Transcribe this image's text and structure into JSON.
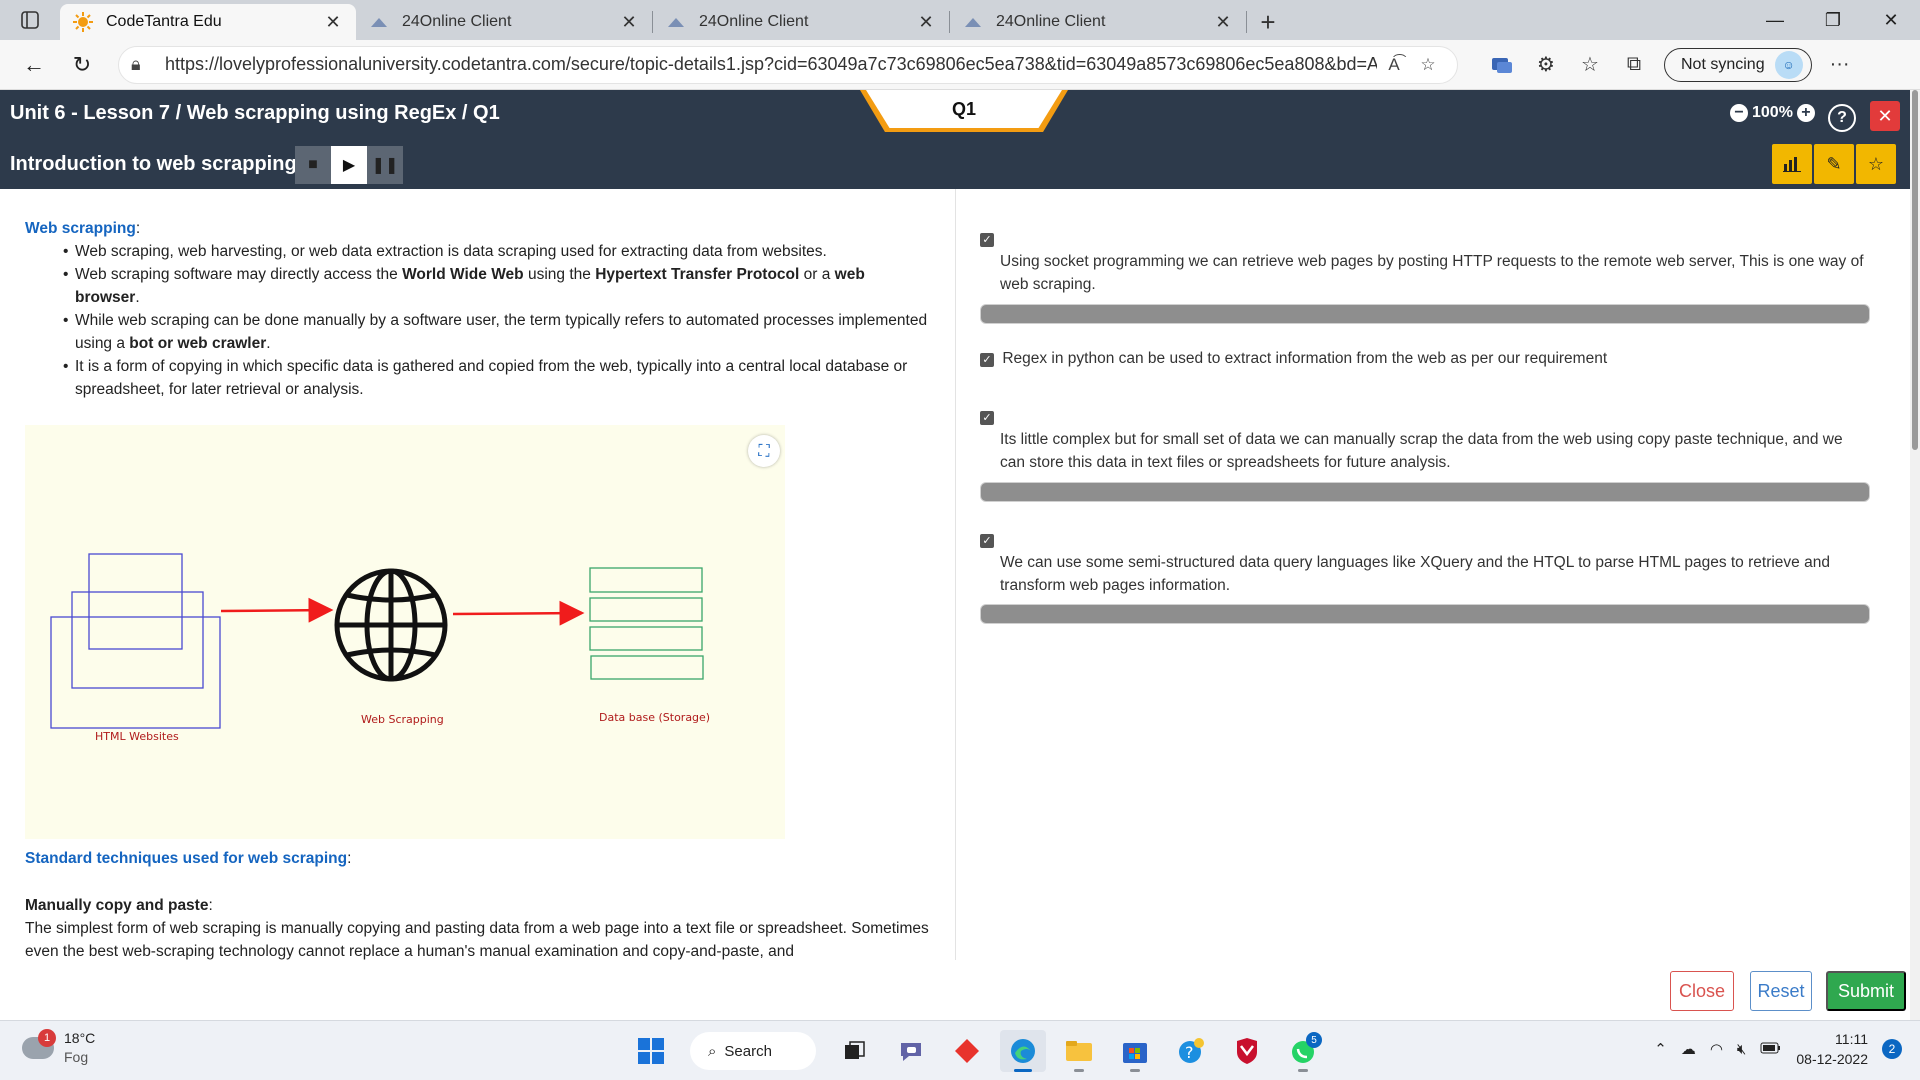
{
  "browser": {
    "tabs": [
      {
        "title": "CodeTantra Edu",
        "active": true
      },
      {
        "title": "24Online Client",
        "active": false
      },
      {
        "title": "24Online Client",
        "active": false
      },
      {
        "title": "24Online Client",
        "active": false
      }
    ],
    "url": "https://lovelyprofessionaluniversity.codetantra.com/secure/topic-details1.jsp?cid=63049a7c73c69806ec5ea738&tid=63049a8573c69806ec5ea808&bd=A...",
    "profile_label": "Not syncing"
  },
  "header": {
    "breadcrumb": "Unit 6 - Lesson 7 / Web scrapping using RegEx / Q1",
    "question_tab": "Q1",
    "lesson_title": "Introduction to web scrapping",
    "zoom_level": "100%",
    "help_label": "?"
  },
  "content": {
    "section1_title": "Web scrapping",
    "bullets": [
      {
        "parts": [
          {
            "t": "Web scraping, web harvesting, or web data extraction is data scraping used for extracting data from websites.",
            "b": false
          }
        ]
      },
      {
        "parts": [
          {
            "t": "Web scraping software may directly access the ",
            "b": false
          },
          {
            "t": "World Wide Web",
            "b": true
          },
          {
            "t": " using the ",
            "b": false
          },
          {
            "t": "Hypertext Transfer Protocol",
            "b": true
          },
          {
            "t": " or a ",
            "b": false
          },
          {
            "t": "web browser",
            "b": true
          },
          {
            "t": ".",
            "b": false
          }
        ]
      },
      {
        "parts": [
          {
            "t": "While web scraping can be done manually by a software user, the term typically refers to automated processes implemented using a ",
            "b": false
          },
          {
            "t": "bot or web crawler",
            "b": true
          },
          {
            "t": ".",
            "b": false
          }
        ]
      },
      {
        "parts": [
          {
            "t": "It is a form of copying in which specific data is gathered and copied from the web, typically into a central local database or spreadsheet, for later retrieval or analysis.",
            "b": false
          }
        ]
      }
    ],
    "diagram": {
      "label_websites": "HTML Websites",
      "label_scrapping": "Web Scrapping",
      "label_database": "Data base (Storage)"
    },
    "section2_title": "Standard techniques used for web scraping",
    "subsection_title": "Manually copy and paste",
    "subsection_text": "The simplest form of web scraping is manually copying and pasting data from a web page into a text file or spreadsheet. Sometimes even the best web-scraping technology cannot replace a human's manual examination and copy-and-paste, and"
  },
  "options": [
    {
      "text": "Using socket programming we can retrieve web pages by posting HTTP requests to the remote web server, This is one way of web scraping.",
      "checked": true
    },
    {
      "text": "Regex in python can be used to extract information from the web as per our requirement",
      "checked": true
    },
    {
      "text": "Its little complex but for small set of data we can manually scrap the data from the web using copy paste technique, and we can store this data in text files or spreadsheets for future analysis.",
      "checked": true
    },
    {
      "text": "We can use some semi-structured data query languages like XQuery and the HTQL to parse HTML pages to retrieve and transform web pages information.",
      "checked": true
    }
  ],
  "actions": {
    "close": "Close",
    "reset": "Reset",
    "submit": "Submit"
  },
  "taskbar": {
    "weather_temp": "18°C",
    "weather_desc": "Fog",
    "weather_badge": "1",
    "search_label": "Search",
    "whatsapp_badge": "5",
    "time": "11:11",
    "date": "08-12-2022",
    "notification_count": "2"
  },
  "colors": {
    "header_bg": "#2d3a4b",
    "accent_blue": "#1565c0",
    "submit_green": "#2fa84f",
    "close_red": "#d9534f",
    "tool_yellow": "#f2b700"
  }
}
